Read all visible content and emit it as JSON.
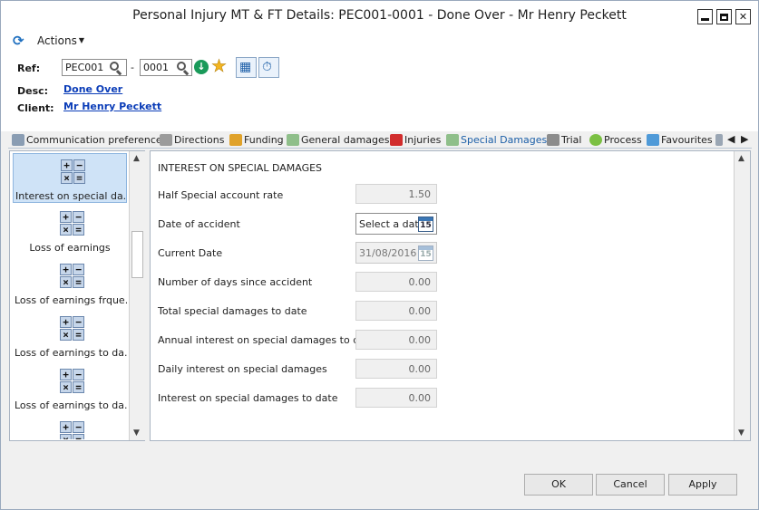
{
  "window": {
    "title": "Personal Injury MT & FT Details: PEC001-0001 - Done Over - Mr Henry Peckett",
    "minimize_label": "",
    "maximize_label": "",
    "close_label": "✕"
  },
  "toolbar": {
    "actions_label": "Actions"
  },
  "header": {
    "ref_label": "Ref:",
    "ref_client_value": "PEC001",
    "ref_separator": "-",
    "ref_matter_value": "0001",
    "desc_label": "Desc:",
    "desc_value": "Done Over",
    "client_label": "Client:",
    "client_value": "Mr Henry Peckett"
  },
  "tabs": [
    {
      "label": "Communication preferences",
      "icon": "person-phone-icon"
    },
    {
      "label": "Directions",
      "icon": "building-icon"
    },
    {
      "label": "Funding",
      "icon": "coins-icon"
    },
    {
      "label": "General damages",
      "icon": "money-icon"
    },
    {
      "label": "Injuries",
      "icon": "first-aid-icon"
    },
    {
      "label": "Special Damages",
      "icon": "money-icon",
      "active": true
    },
    {
      "label": "Trial",
      "icon": "court-icon"
    },
    {
      "label": "Process",
      "icon": "green-plus-icon"
    },
    {
      "label": "Favourites",
      "icon": "star-icon"
    }
  ],
  "nav": {
    "items": [
      {
        "label": "Interest on special da...",
        "selected": true
      },
      {
        "label": "Loss of earnings"
      },
      {
        "label": "Loss of earnings frque..."
      },
      {
        "label": "Loss of earnings to da..."
      },
      {
        "label": "Loss of earnings to da..."
      }
    ]
  },
  "form": {
    "section_title": "INTEREST ON SPECIAL DAMAGES",
    "half_rate_label": "Half Special account rate",
    "half_rate_value": "1.50",
    "date_of_accident_label": "Date of accident",
    "date_of_accident_placeholder": "Select a date",
    "current_date_label": "Current Date",
    "current_date_value": "31/08/2016",
    "days_label": "Number of days since accident",
    "days_value": "0.00",
    "total_label": "Total special damages to date",
    "total_value": "0.00",
    "annual_label": "Annual interest on special damages to date",
    "annual_value": "0.00",
    "daily_label": "Daily interest on special damages",
    "daily_value": "0.00",
    "interest_to_date_label": "Interest on special damages to date",
    "interest_to_date_value": "0.00",
    "calendar_day": "15"
  },
  "buttons": {
    "ok": "OK",
    "cancel": "Cancel",
    "apply": "Apply"
  },
  "colors": {
    "link": "#0b3db8",
    "selected_nav": "#cfe3f7",
    "active_tab": "#1c5fa8"
  }
}
